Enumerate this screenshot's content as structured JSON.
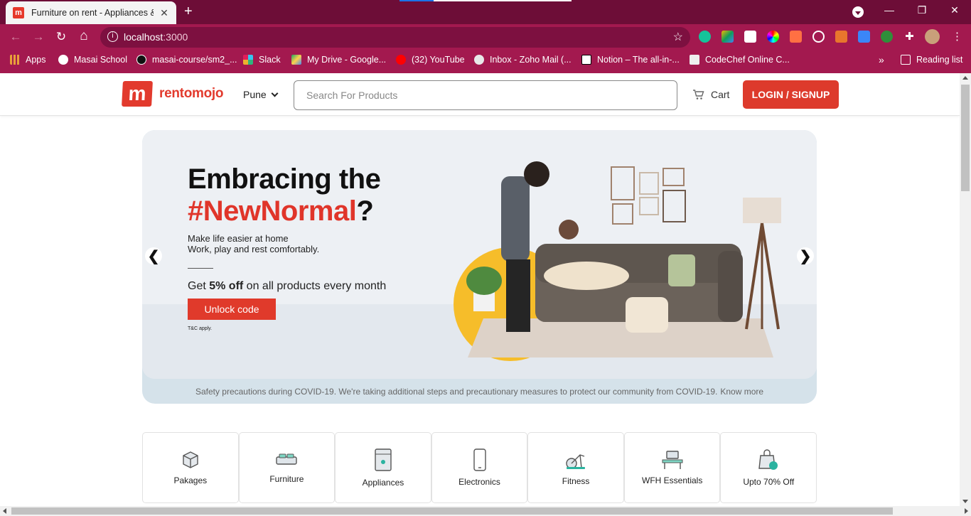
{
  "browser": {
    "tab_title": "Furniture on rent - Appliances &",
    "tab_favicon_letter": "m",
    "new_tab_label": "+",
    "url_host": "localhost",
    "url_port": ":3000",
    "window_controls": {
      "minimize": "—",
      "restore": "❐",
      "close": "✕"
    },
    "nav": {
      "back": "←",
      "forward": "→",
      "reload": "↻",
      "home": "⌂"
    }
  },
  "bookmarks": [
    {
      "label": "Apps",
      "icon": "apps-grid-icon",
      "color": "#e8a03a"
    },
    {
      "label": "Masai School",
      "icon": "globe-icon",
      "color": "#ffffff"
    },
    {
      "label": "masai-course/sm2_...",
      "icon": "github-icon",
      "color": "#111111"
    },
    {
      "label": "Slack",
      "icon": "slack-icon",
      "color": "#e01e5a"
    },
    {
      "label": "My Drive - Google...",
      "icon": "google-drive-icon",
      "color": "#1fa463"
    },
    {
      "label": "(32) YouTube",
      "icon": "youtube-icon",
      "color": "#ff0000"
    },
    {
      "label": "Inbox - Zoho Mail (...",
      "icon": "zoho-mail-icon",
      "color": "#e8e8e8"
    },
    {
      "label": "Notion – The all-in-...",
      "icon": "notion-icon",
      "color": "#ffffff"
    },
    {
      "label": "CodeChef Online C...",
      "icon": "codechef-icon",
      "color": "#eeeeee"
    }
  ],
  "bookmarks_overflow": "»",
  "reading_list": "Reading list",
  "site": {
    "logo_letter": "m",
    "logo_text": "rentomojo",
    "city": "Pune",
    "search_placeholder": "Search For Products",
    "cart_label": "Cart",
    "login_label": "LOGIN / SIGNUP",
    "brand_color": "#e03a2b"
  },
  "banner": {
    "headline_1": "Embracing the",
    "headline_hashtag": "#NewNormal",
    "headline_q": "?",
    "sub_1": "Make life easier at home",
    "sub_2": "Work, play and rest comfortably.",
    "offer_pre": "Get ",
    "offer_bold": "5% off",
    "offer_post": " on all products every month",
    "cta": "Unlock code",
    "tc": "T&C apply.",
    "prev_arrow": "❮",
    "next_arrow": "❯",
    "covid_text": "Safety precautions during COVID-19. We're taking additional steps and precautionary measures to protect our community from COVID-19.",
    "covid_link": "Know more"
  },
  "categories": [
    {
      "label": "Pakages",
      "icon": "package-box-icon"
    },
    {
      "label": "Furniture",
      "icon": "bed-icon"
    },
    {
      "label": "Appliances",
      "icon": "washing-machine-icon"
    },
    {
      "label": "Electronics",
      "icon": "smartphone-icon"
    },
    {
      "label": "Fitness",
      "icon": "exercise-bike-icon"
    },
    {
      "label": "WFH Essentials",
      "icon": "desk-icon"
    },
    {
      "label": "Upto 70% Off",
      "icon": "discount-bag-icon"
    }
  ]
}
